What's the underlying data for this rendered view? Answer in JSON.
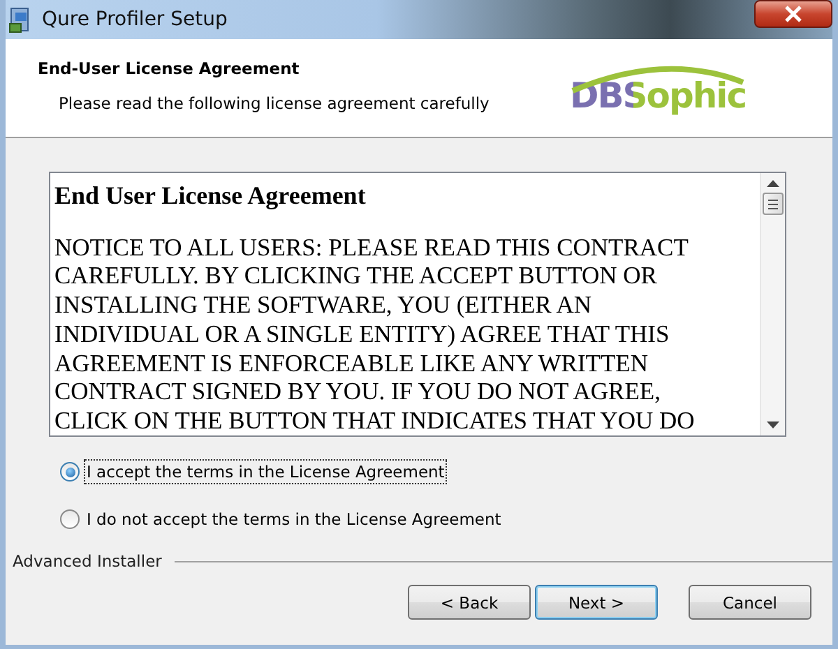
{
  "window": {
    "title": "Qure Profiler Setup"
  },
  "header": {
    "title": "End-User License Agreement",
    "subtitle": "Please read the following license agreement carefully",
    "logo": "DBSophic"
  },
  "license": {
    "heading": "End User License Agreement",
    "lines": [
      "NOTICE TO ALL USERS: PLEASE READ THIS CONTRACT",
      "CAREFULLY. BY CLICKING THE ACCEPT BUTTON OR",
      "INSTALLING THE SOFTWARE, YOU (EITHER AN",
      "INDIVIDUAL OR A SINGLE ENTITY) AGREE THAT THIS",
      "AGREEMENT IS ENFORCEABLE LIKE ANY WRITTEN",
      "CONTRACT SIGNED BY YOU. IF YOU DO NOT AGREE,",
      "CLICK ON THE BUTTON THAT INDICATES THAT YOU DO"
    ]
  },
  "options": [
    {
      "label": "I accept the terms in the License Agreement",
      "selected": true
    },
    {
      "label": "I do not accept the terms in the License Agreement",
      "selected": false
    }
  ],
  "footer": {
    "brand": "Advanced Installer"
  },
  "buttons": [
    {
      "label": "< Back",
      "kind": "normal"
    },
    {
      "label": "Next >",
      "kind": "default"
    },
    {
      "label": "Cancel",
      "kind": "cancel"
    }
  ]
}
